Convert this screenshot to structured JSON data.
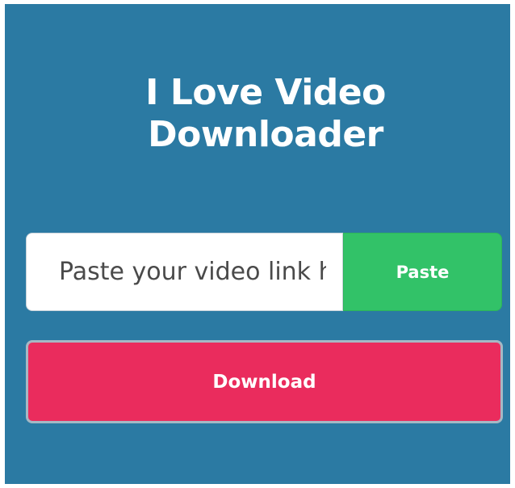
{
  "header": {
    "title_line1": "I Love Video",
    "title_line2": "Downloader"
  },
  "form": {
    "url_placeholder": "Paste your video link here",
    "url_value": "",
    "paste_label": "Paste",
    "download_label": "Download"
  },
  "colors": {
    "panel_background": "#2b7aa3",
    "paste_button": "#32c268",
    "download_button": "#ea2c5d",
    "text_on_color": "#ffffff"
  }
}
